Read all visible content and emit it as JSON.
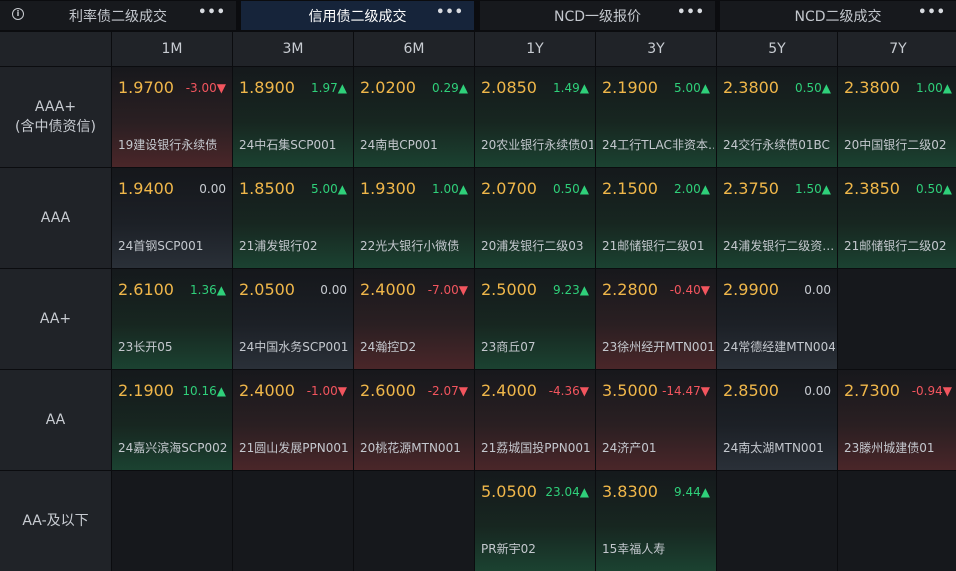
{
  "tabs": [
    {
      "label": "利率债二级成交",
      "active": false
    },
    {
      "label": "信用债二级成交",
      "active": true
    },
    {
      "label": "NCD一级报价",
      "active": false
    },
    {
      "label": "NCD二级成交",
      "active": false
    }
  ],
  "more_label": "•••",
  "info_glyph": "i",
  "columns": [
    "1M",
    "3M",
    "6M",
    "1Y",
    "3Y",
    "5Y",
    "7Y"
  ],
  "rows": [
    {
      "label": "AAA+\n(含中债资信)",
      "cells": [
        {
          "yield": "1.9700",
          "change": "-3.00▼",
          "dir": "down",
          "bond": "19建设银行永续债"
        },
        {
          "yield": "1.8900",
          "change": "1.97▲",
          "dir": "up",
          "bond": "24中石集SCP001"
        },
        {
          "yield": "2.0200",
          "change": "0.29▲",
          "dir": "up",
          "bond": "24南电CP001"
        },
        {
          "yield": "2.0850",
          "change": "1.49▲",
          "dir": "up",
          "bond": "20农业银行永续债01"
        },
        {
          "yield": "2.1900",
          "change": "5.00▲",
          "dir": "up",
          "bond": "24工行TLAC非资本…"
        },
        {
          "yield": "2.3800",
          "change": "0.50▲",
          "dir": "up",
          "bond": "24交行永续债01BC"
        },
        {
          "yield": "2.3800",
          "change": "1.00▲",
          "dir": "up",
          "bond": "20中国银行二级02"
        }
      ]
    },
    {
      "label": "AAA",
      "cells": [
        {
          "yield": "1.9400",
          "change": "0.00",
          "dir": "flat",
          "bond": "24首钢SCP001"
        },
        {
          "yield": "1.8500",
          "change": "5.00▲",
          "dir": "up",
          "bond": "21浦发银行02"
        },
        {
          "yield": "1.9300",
          "change": "1.00▲",
          "dir": "up",
          "bond": "22光大银行小微债"
        },
        {
          "yield": "2.0700",
          "change": "0.50▲",
          "dir": "up",
          "bond": "20浦发银行二级03"
        },
        {
          "yield": "2.1500",
          "change": "2.00▲",
          "dir": "up",
          "bond": "21邮储银行二级01"
        },
        {
          "yield": "2.3750",
          "change": "1.50▲",
          "dir": "up",
          "bond": "24浦发银行二级资…"
        },
        {
          "yield": "2.3850",
          "change": "0.50▲",
          "dir": "up",
          "bond": "21邮储银行二级02"
        }
      ]
    },
    {
      "label": "AA+",
      "cells": [
        {
          "yield": "2.6100",
          "change": "1.36▲",
          "dir": "up",
          "bond": "23长开05"
        },
        {
          "yield": "2.0500",
          "change": "0.00",
          "dir": "flat",
          "bond": "24中国水务SCP001"
        },
        {
          "yield": "2.4000",
          "change": "-7.00▼",
          "dir": "down",
          "bond": "24瀚控D2"
        },
        {
          "yield": "2.5000",
          "change": "9.23▲",
          "dir": "up",
          "bond": "23商丘07"
        },
        {
          "yield": "2.2800",
          "change": "-0.40▼",
          "dir": "down",
          "bond": "23徐州经开MTN001"
        },
        {
          "yield": "2.9900",
          "change": "0.00",
          "dir": "flat",
          "bond": "24常德经建MTN004"
        },
        null
      ]
    },
    {
      "label": "AA",
      "cells": [
        {
          "yield": "2.1900",
          "change": "10.16▲",
          "dir": "up",
          "bond": "24嘉兴滨海SCP002"
        },
        {
          "yield": "2.4000",
          "change": "-1.00▼",
          "dir": "down",
          "bond": "21圆山发展PPN001"
        },
        {
          "yield": "2.6000",
          "change": "-2.07▼",
          "dir": "down",
          "bond": "20桃花源MTN001"
        },
        {
          "yield": "2.4000",
          "change": "-4.36▼",
          "dir": "down",
          "bond": "21荔城国投PPN001"
        },
        {
          "yield": "3.5000",
          "change": "-14.47▼",
          "dir": "down",
          "bond": "24济产01"
        },
        {
          "yield": "2.8500",
          "change": "0.00",
          "dir": "flat",
          "bond": "24南太湖MTN001"
        },
        {
          "yield": "2.7300",
          "change": "-0.94▼",
          "dir": "down",
          "bond": "23滕州城建债01"
        }
      ]
    },
    {
      "label": "AA-及以下",
      "cells": [
        null,
        null,
        null,
        {
          "yield": "5.0500",
          "change": "23.04▲",
          "dir": "up",
          "bond": "PR新宇02"
        },
        {
          "yield": "3.8300",
          "change": "9.44▲",
          "dir": "up",
          "bond": "15幸福人寿"
        },
        null,
        null
      ]
    }
  ]
}
